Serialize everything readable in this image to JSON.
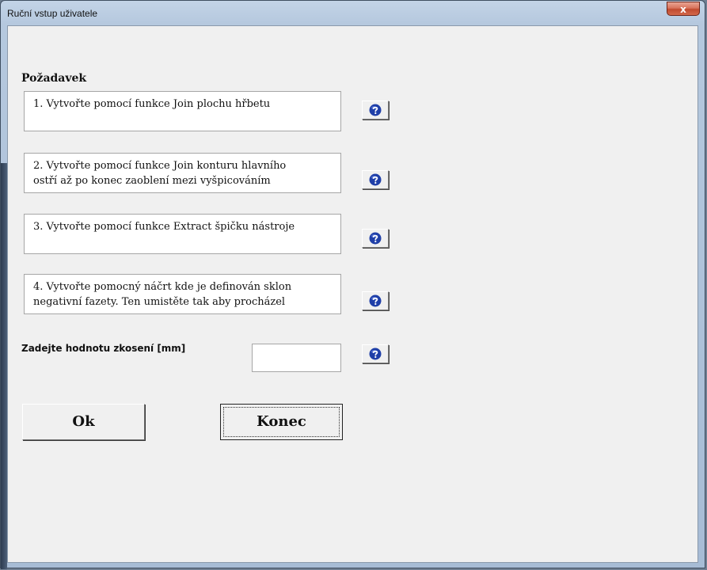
{
  "window": {
    "title": "Ruční vstup uživatele",
    "close_label": "x"
  },
  "section": {
    "title": "Požadavek"
  },
  "requirements": [
    {
      "lines": [
        "1. Vytvořte pomocí funkce Join plochu hřbetu"
      ]
    },
    {
      "lines": [
        "2. Vytvořte pomocí funkce Join konturu hlavního",
        "ostří až po konec zaoblení mezi vyšpicováním"
      ]
    },
    {
      "lines": [
        "3. Vytvořte pomocí funkce Extract špičku nástroje"
      ]
    },
    {
      "lines": [
        "4. Vytvořte pomocný náčrt kde je definován sklon",
        "negativní fazety. Ten umistěte tak aby procházel"
      ]
    }
  ],
  "chamfer": {
    "label": "Zadejte hodnotu zkosení [mm]",
    "value": ""
  },
  "buttons": {
    "ok_label": "Ok",
    "end_label": "Konec"
  },
  "colors": {
    "help_icon": "#1f3fa8",
    "close_button": "#c8523a"
  },
  "icons": {
    "help": "question-mark-icon",
    "close": "close-icon"
  }
}
